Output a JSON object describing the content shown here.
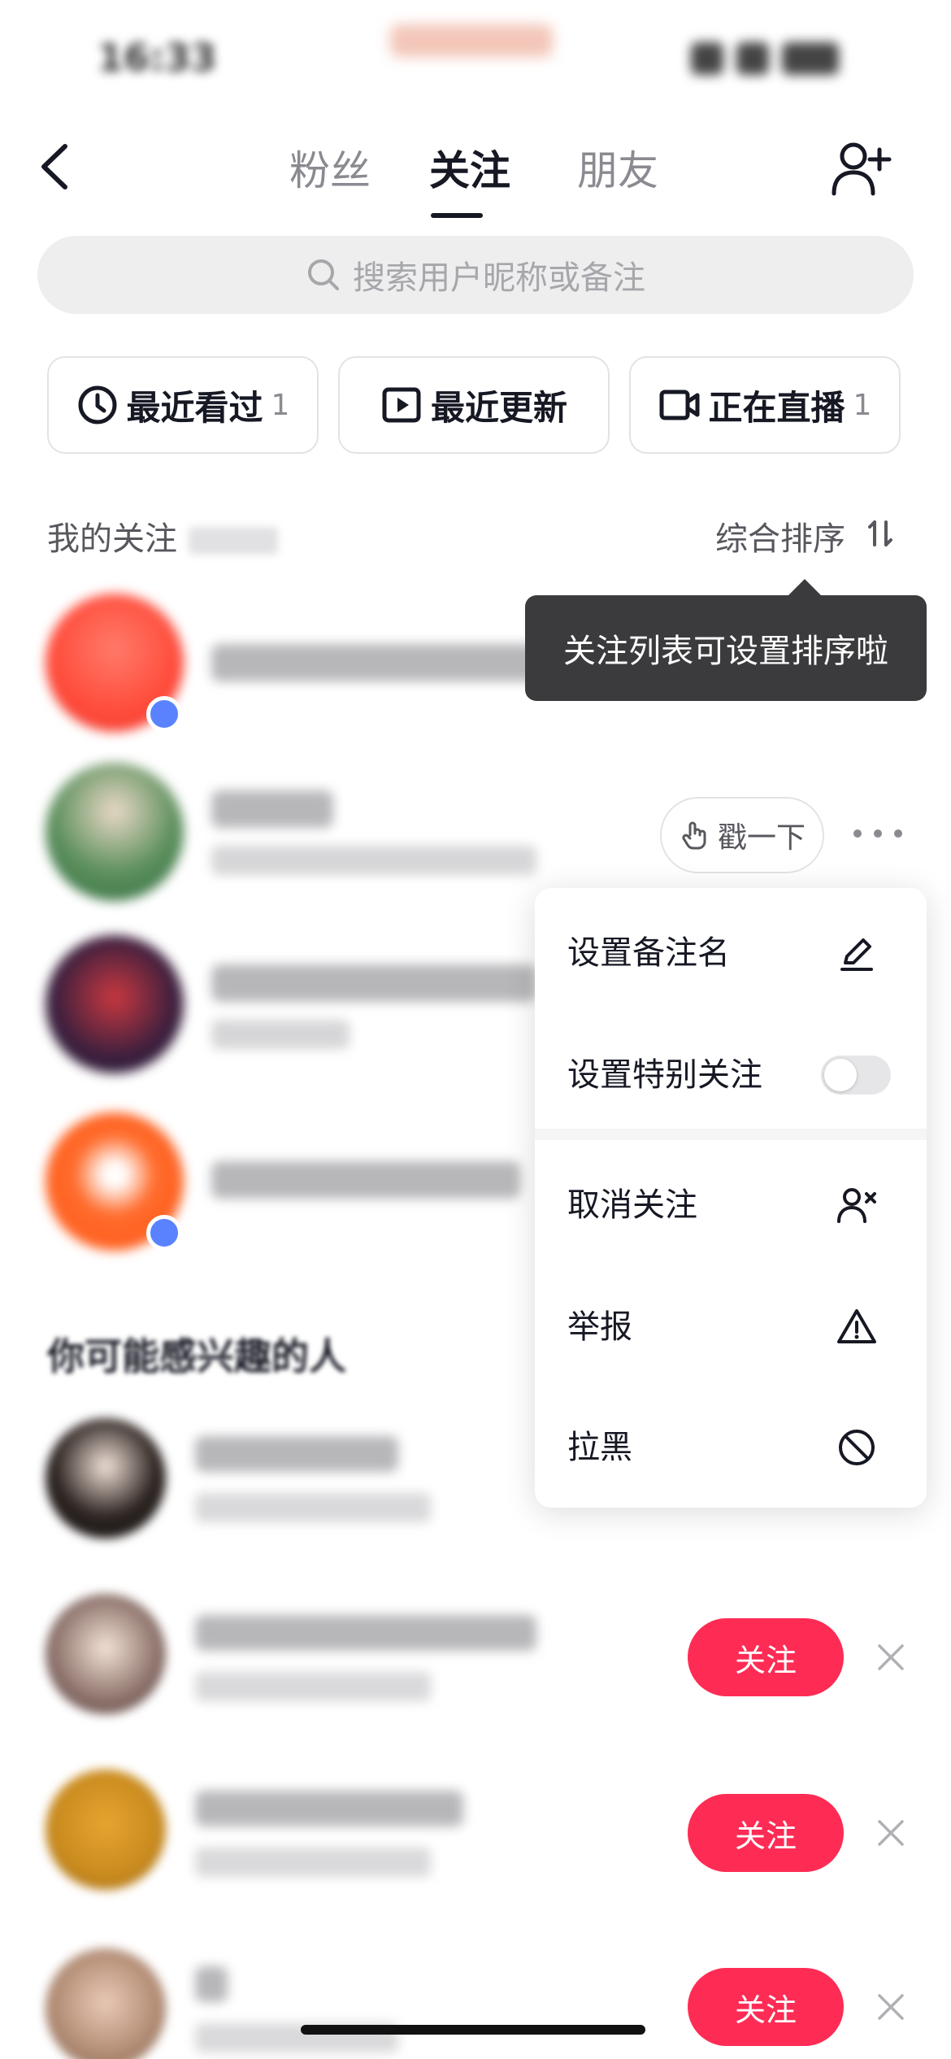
{
  "status_bar": {
    "time": "16:33"
  },
  "nav": {
    "tabs": [
      {
        "label": "粉丝",
        "active": false
      },
      {
        "label": "关注",
        "active": true
      },
      {
        "label": "朋友",
        "active": false
      }
    ]
  },
  "search": {
    "placeholder": "搜索用户昵称或备注"
  },
  "filters": [
    {
      "label": "最近看过",
      "count": "1",
      "icon": "clock-icon"
    },
    {
      "label": "最近更新",
      "count": "",
      "icon": "play-square-icon"
    },
    {
      "label": "正在直播",
      "count": "1",
      "icon": "video-camera-icon"
    }
  ],
  "section": {
    "title": "我的关注",
    "sort_label": "综合排序"
  },
  "tooltip": {
    "text": "关注列表可设置排序啦"
  },
  "poke": {
    "label": "戳一下"
  },
  "menu": {
    "items": [
      {
        "label": "设置备注名",
        "icon": "edit-pen-icon"
      },
      {
        "label": "设置特别关注",
        "toggle": false
      },
      {
        "label": "取消关注",
        "icon": "unfollow-user-icon"
      },
      {
        "label": "举报",
        "icon": "warning-triangle-icon"
      },
      {
        "label": "拉黑",
        "icon": "block-icon"
      }
    ]
  },
  "suggest": {
    "title": "你可能感兴趣的人",
    "follow_label": "关注"
  },
  "colors": {
    "accent": "#fe2c55",
    "tooltip_bg": "#3b3b3d"
  }
}
